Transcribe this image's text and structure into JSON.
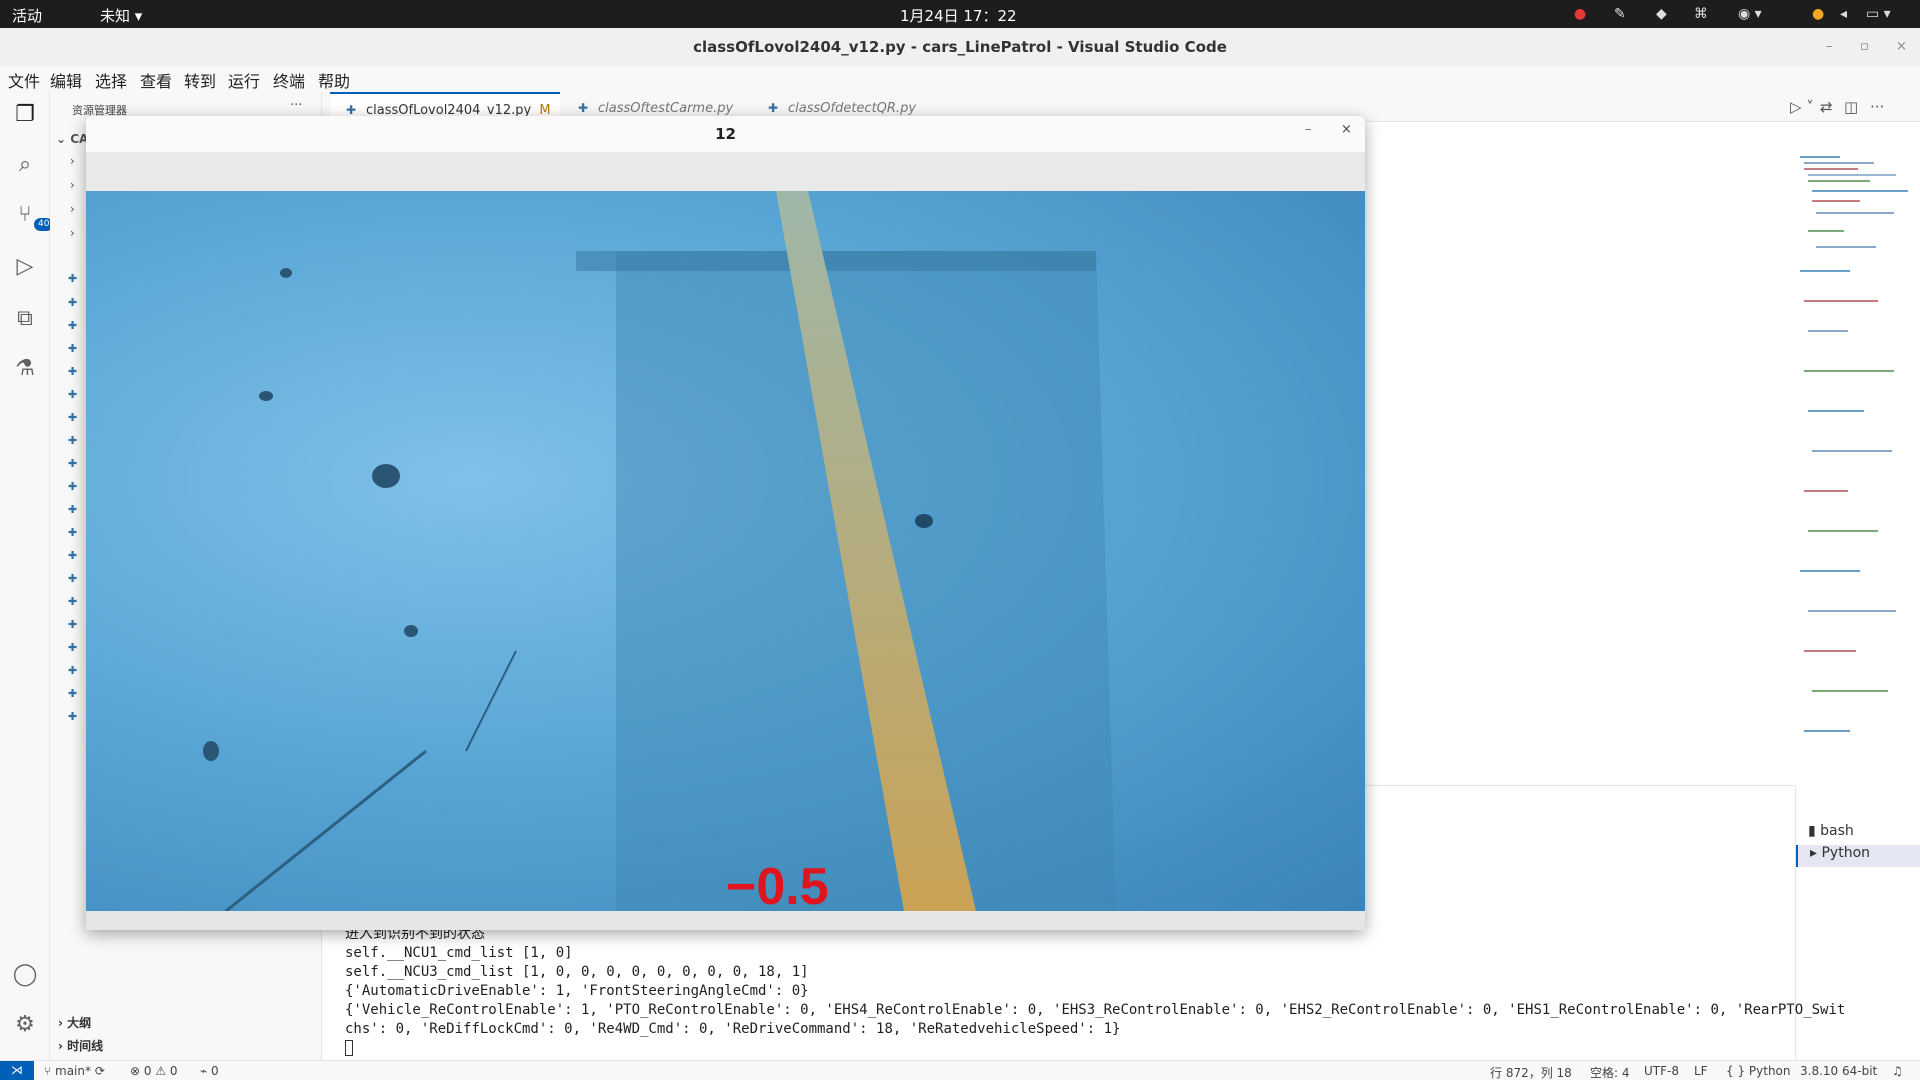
{
  "topbar": {
    "activities": "活动",
    "unknown": "未知 ▾",
    "clock": "1月24日 17：22"
  },
  "window": {
    "title": "classOfLovol2404_v12.py - cars_LinePatrol - Visual Studio Code"
  },
  "menu": [
    "文件",
    "编辑",
    "选择",
    "查看",
    "转到",
    "运行",
    "终端",
    "帮助"
  ],
  "activity": {
    "scm_badge": "40"
  },
  "sidebar": {
    "header": "资源管理器",
    "more": "···",
    "folder": "CA",
    "outline": "大纲",
    "timeline": "时间线"
  },
  "tabs": [
    {
      "label": "classOfLovol2404_v12.py",
      "modified": "M",
      "close": "×"
    },
    {
      "label": "classOftestCarme.py"
    },
    {
      "label": "classOfdetectQR.py"
    }
  ],
  "panel": {
    "terminals": [
      "bash",
      "Python"
    ]
  },
  "terminal": {
    "lines": [
      "进入到识别不到的状态",
      "self.__NCU1_cmd_list [1, 0]",
      "self.__NCU3_cmd_list [1, 0, 0, 0, 0, 0, 0, 0, 0, 18, 1]",
      "{'AutomaticDriveEnable': 1, 'FrontSteeringAngleCmd': 0}",
      "{'Vehicle_ReControlEnable': 1, 'PTO_ReControlEnable': 0, 'EHS4_ReControlEnable': 0, 'EHS3_ReControlEnable': 0, 'EHS2_ReControlEnable': 0, 'EHS1_ReControlEnable': 0, 'RearPTO_Swit",
      "chs': 0, 'ReDiffLockCmd': 0, 'Re4WD_Cmd': 0, 'ReDriveCommand': 18, 'ReRatedvehicleSpeed': 1}"
    ]
  },
  "cv_window": {
    "title": "12",
    "min": "–",
    "close": "×",
    "readout": "−0.5"
  },
  "status": {
    "branch": "main*",
    "errors": "0",
    "warnings": "0",
    "ports": "0",
    "position": "行 872，列 18",
    "spaces": "空格: 4",
    "encoding": "UTF-8",
    "eol": "LF",
    "language": "Python",
    "interpreter": "3.8.10 64-bit"
  },
  "colors": {
    "accent": "#005fb8",
    "readout": "#e0141e",
    "topbar": "#1d1d1d"
  }
}
